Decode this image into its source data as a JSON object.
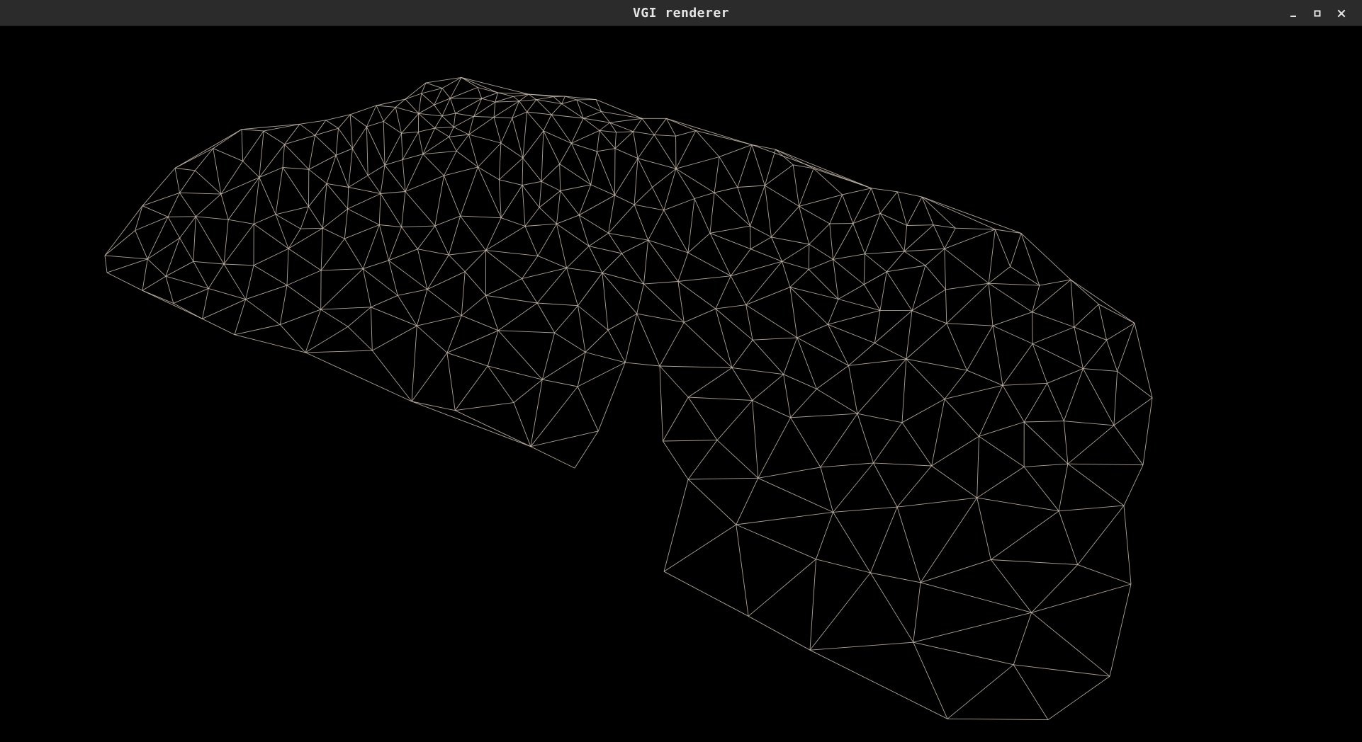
{
  "window": {
    "title": "VGI renderer"
  },
  "controls": {
    "minimize_icon": "minimize-icon",
    "maximize_icon": "maximize-icon",
    "close_icon": "close-icon"
  },
  "render": {
    "mode": "wireframe",
    "background_color": "#000000",
    "wire_color": "#cdbfae",
    "titlebar_color": "#2b2b2b"
  }
}
